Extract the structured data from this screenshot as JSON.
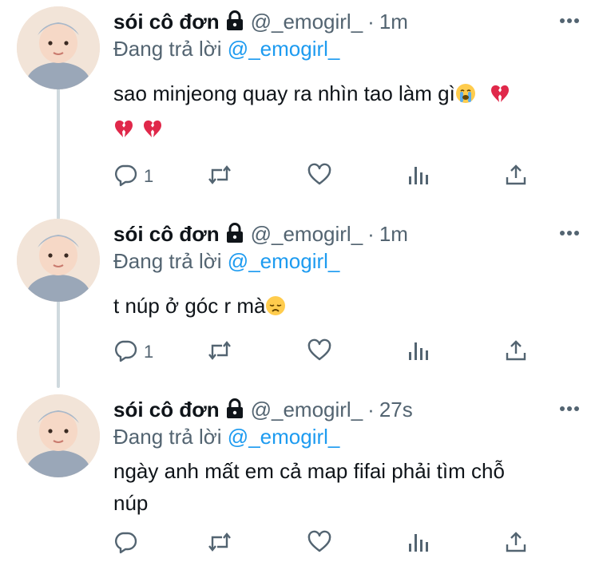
{
  "tweets": [
    {
      "display_name": "sói cô đơn",
      "handle": "@_emogirl_",
      "separator": "·",
      "time": "1m",
      "reply_prefix": "Đang trả lời",
      "reply_to": "@_emogirl_",
      "text_line1": "sao minjeong quay ra nhìn tao làm gì",
      "emojis": [
        "loudly-crying-face",
        "broken-heart",
        "broken-heart",
        "broken-heart"
      ],
      "reply_count": "1"
    },
    {
      "display_name": "sói cô đơn",
      "handle": "@_emogirl_",
      "separator": "·",
      "time": "1m",
      "reply_prefix": "Đang trả lời",
      "reply_to": "@_emogirl_",
      "text_line1": "t núp ở góc r mà",
      "emojis": [
        "disappointed-face"
      ],
      "reply_count": "1"
    },
    {
      "display_name": "sói cô đơn",
      "handle": "@_emogirl_",
      "separator": "·",
      "time": "27s",
      "reply_prefix": "Đang trả lời",
      "reply_to": "@_emogirl_",
      "text_line1": "ngày anh mất em cả map fifai phải tìm chỗ",
      "text_line2": "núp",
      "reply_count": ""
    }
  ],
  "colors": {
    "text": "#0f1419",
    "secondary": "#536471",
    "link": "#1d9bf0",
    "thread_line": "#cfd9de",
    "broken_heart": "#e0284a"
  },
  "icons": [
    "lock-icon",
    "more-icon",
    "reply-icon",
    "retweet-icon",
    "like-icon",
    "views-icon",
    "share-icon"
  ]
}
